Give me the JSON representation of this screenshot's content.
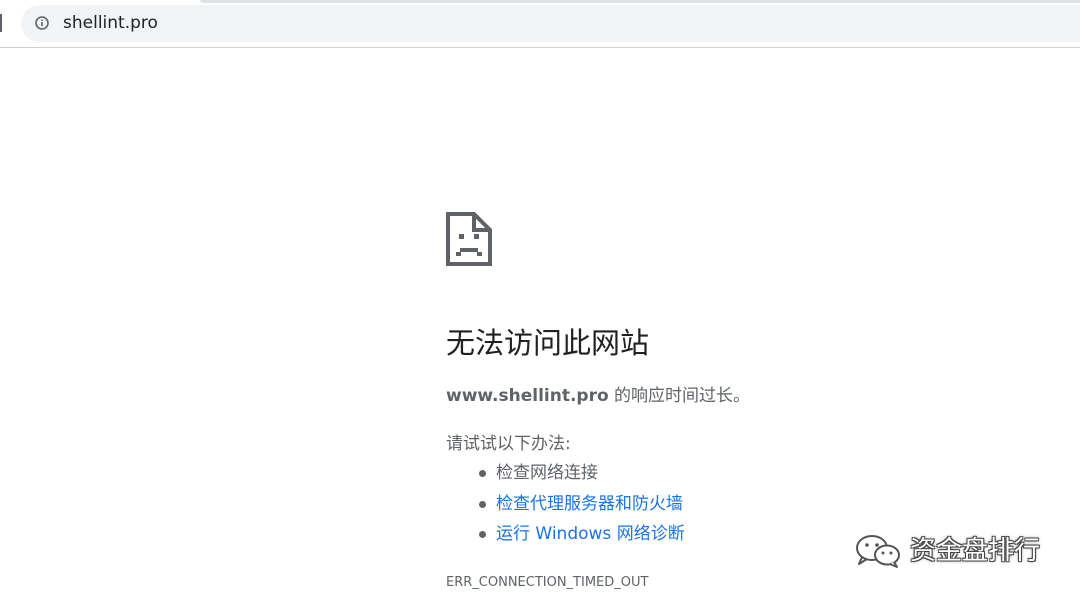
{
  "browser": {
    "url": "shellint.pro",
    "site_info_icon": "info-circle-icon"
  },
  "error": {
    "icon": "sad-page-icon",
    "title": "无法访问此网站",
    "host": "www.shellint.pro",
    "message": " 的响应时间过长。",
    "suggestions_heading": "请试试以下办法:",
    "suggestions": [
      {
        "label": "检查网络连接",
        "is_link": false
      },
      {
        "label": "检查代理服务器和防火墙",
        "is_link": true
      },
      {
        "label": "运行 Windows 网络诊断",
        "is_link": true
      }
    ],
    "code": "ERR_CONNECTION_TIMED_OUT"
  },
  "watermark": {
    "icon": "wechat-icon",
    "text": "资金盘排行"
  },
  "colors": {
    "link": "#1a73e8",
    "body_text": "#5f6368",
    "title_text": "#202124",
    "omnibox_bg": "#f1f3f4"
  }
}
